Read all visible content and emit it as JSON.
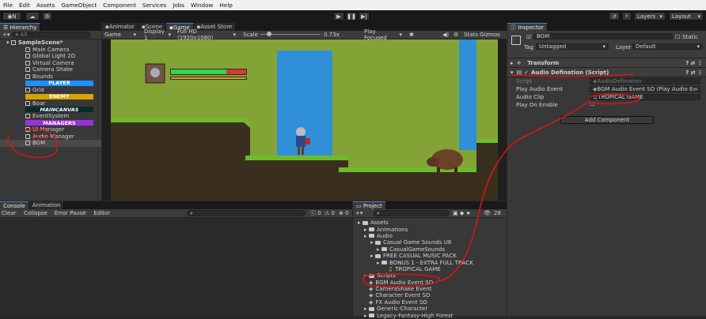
{
  "menu": [
    "File",
    "Edit",
    "Assets",
    "GameObject",
    "Component",
    "Services",
    "Jobs",
    "Window",
    "Help"
  ],
  "toolbar": {
    "account_label": "N",
    "layers_label": "Layers",
    "layout_label": "Layout"
  },
  "hierarchy": {
    "tab": "Hierarchy",
    "search_placeholder": "All",
    "scene": "SampleScene*",
    "items": [
      {
        "label": "Main Camera",
        "type": "obj"
      },
      {
        "label": "Global Light 2D",
        "type": "obj"
      },
      {
        "label": "Virtual Camera",
        "type": "obj"
      },
      {
        "label": "Camera Shake",
        "type": "obj"
      },
      {
        "label": "Bounds",
        "type": "obj"
      },
      {
        "label": "PLAYER",
        "type": "bar",
        "color": "#1e90ff"
      },
      {
        "label": "Grid",
        "type": "obj"
      },
      {
        "label": "ENEMY",
        "type": "bar",
        "color": "#d6a400"
      },
      {
        "label": "Boar",
        "type": "obj"
      },
      {
        "label": "MAINCANVAS",
        "type": "bar",
        "color": "#0a2a2a"
      },
      {
        "label": "EventSystem",
        "type": "obj"
      },
      {
        "label": "MANAGERS",
        "type": "bar",
        "color": "#9b30d9"
      },
      {
        "label": "UI Manager",
        "type": "obj"
      },
      {
        "label": "Audio Manager",
        "type": "obj"
      },
      {
        "label": "BGM",
        "type": "obj",
        "selected": true
      }
    ]
  },
  "scene_tabs": [
    "Animator",
    "Scene",
    "Game",
    "Asset Store"
  ],
  "game_bar": {
    "mode": "Game",
    "display": "Display 1",
    "resolution": "Full HD (1920x1080)",
    "scale_label": "Scale",
    "scale_value": "0.73x",
    "play_focus": "Play Focused",
    "stats": "Stats",
    "gizmos": "Gizmos"
  },
  "console": {
    "tabs": [
      "Console",
      "Animation"
    ],
    "buttons": [
      "Clear",
      "Collapse",
      "Error Pause",
      "Editor"
    ],
    "counts": [
      "0",
      "0",
      "0"
    ]
  },
  "project": {
    "tab": "Project",
    "count": "28",
    "items": [
      {
        "label": "Assets",
        "depth": 0
      },
      {
        "label": "Animations",
        "depth": 1
      },
      {
        "label": "Audio",
        "depth": 1
      },
      {
        "label": "Casual Game Sounds U6",
        "depth": 2
      },
      {
        "label": "CasualGameSounds",
        "depth": 3
      },
      {
        "label": "FREE CASUAL MUSIC PACK",
        "depth": 2
      },
      {
        "label": "BONUS 1 - EXTRA FULL TRACK",
        "depth": 3
      },
      {
        "label": "TROPICAL GAME",
        "depth": 4
      },
      {
        "label": "Scripts",
        "depth": 1
      },
      {
        "label": "BGM Audio Event SO",
        "depth": 1
      },
      {
        "label": "CameraShake Event",
        "depth": 1
      },
      {
        "label": "Character Event SO",
        "depth": 1
      },
      {
        "label": "FX Audio Event SO",
        "depth": 1
      },
      {
        "label": "Generic-Character",
        "depth": 1
      },
      {
        "label": "Legacy-Fantasy-High Forest",
        "depth": 1
      }
    ]
  },
  "inspector": {
    "tab": "Inspector",
    "object_name": "BGM",
    "static_label": "Static",
    "tag_label": "Tag",
    "tag_value": "Untagged",
    "layer_label": "Layer",
    "layer_value": "Default",
    "transform": "Transform",
    "component": "Audio Defination (Script)",
    "fields": [
      {
        "label": "Script",
        "value": "AudioDefination"
      },
      {
        "label": "Play Audio Event",
        "value": "BGM Audio Event SO (Play Audio Event SO"
      },
      {
        "label": "Audio Clip",
        "value": "TROPICAL GAME"
      },
      {
        "label": "Play On Enable",
        "value": ""
      }
    ],
    "add_component": "Add Component"
  }
}
